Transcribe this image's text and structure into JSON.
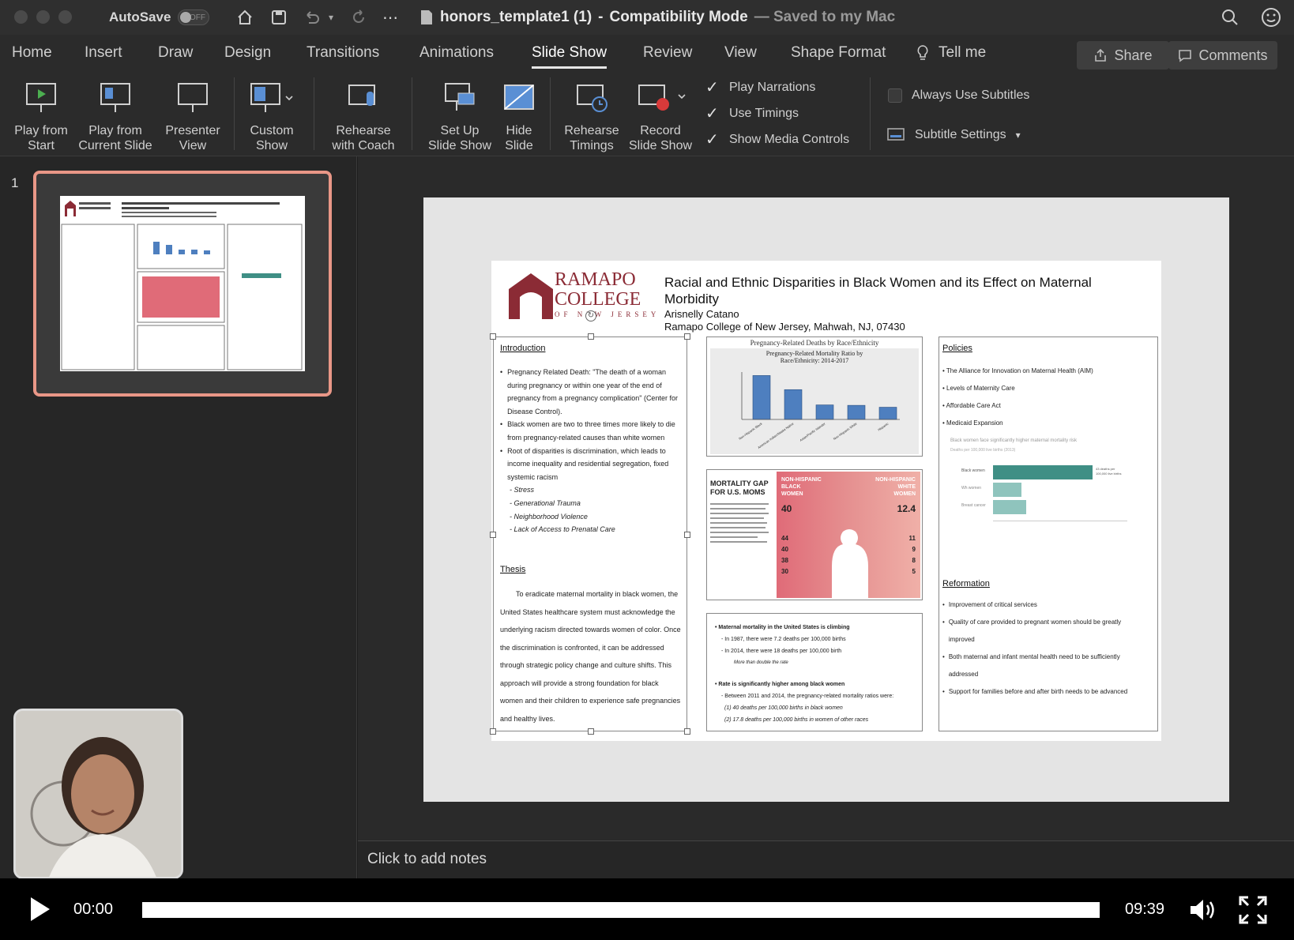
{
  "titlebar": {
    "autosave_label": "AutoSave",
    "autosave_state": "OFF",
    "doc_title": "honors_template1 (1)",
    "separator": "-",
    "mode": "Compatibility Mode",
    "saved_status": "— Saved to my Mac"
  },
  "tabs": [
    "Home",
    "Insert",
    "Draw",
    "Design",
    "Transitions",
    "Animations",
    "Slide Show",
    "Review",
    "View",
    "Shape Format"
  ],
  "active_tab": "Slide Show",
  "tell_me": "Tell me",
  "share_label": "Share",
  "comments_label": "Comments",
  "ribbon": {
    "play_start": [
      "Play from",
      "Start"
    ],
    "play_current": [
      "Play from",
      "Current Slide"
    ],
    "presenter": [
      "Presenter",
      "View"
    ],
    "custom": [
      "Custom",
      "Show"
    ],
    "rehearse_coach": [
      "Rehearse",
      "with Coach"
    ],
    "setup": [
      "Set Up",
      "Slide Show"
    ],
    "hide": [
      "Hide",
      "Slide"
    ],
    "rehearse_timings": [
      "Rehearse",
      "Timings"
    ],
    "record": [
      "Record",
      "Slide Show"
    ],
    "play_narrations": "Play Narrations",
    "use_timings": "Use Timings",
    "show_media_controls": "Show Media Controls",
    "always_subtitles": "Always Use Subtitles",
    "subtitle_settings": "Subtitle Settings"
  },
  "thumbnail_number": "1",
  "notes_placeholder": "Click to add notes",
  "poster": {
    "logo_line1": "RAMAPO",
    "logo_line2": "COLLEGE",
    "logo_line3": "OF NEW JERSEY",
    "title": "Racial and Ethnic Disparities in Black Women and its Effect on Maternal Morbidity",
    "author": "Arisnelly Catano",
    "affiliation": "Ramapo College of New Jersey, Mahwah, NJ, 07430",
    "intro_heading": "Introduction",
    "intro_items": [
      "Pregnancy Related Death: \"The death of a woman during pregnancy or within one year of the end of pregnancy from a pregnancy complication\" (Center for Disease Control).",
      "Black women are two to three times more likely to die from pregnancy-related causes than white women",
      "Root of disparities is discrimination, which leads to income inequality and residential segregation, fixed systemic racism"
    ],
    "intro_sub": [
      "- Stress",
      "- Generational Trauma",
      "- Neighborhood Violence",
      "- Lack of Access to Prenatal Care"
    ],
    "thesis_heading": "Thesis",
    "thesis_text": "To eradicate maternal mortality in black women, the United States healthcare system must acknowledge the underlying racism directed towards women of color. Once the discrimination is confronted, it can be addressed through strategic policy change and culture shifts. This approach will provide a strong foundation for black women and their children to experience safe pregnancies and healthy lives.",
    "chart_title": "Pregnancy-Related Deaths by Race/Ethnicity",
    "chart_inner_title": "Pregnancy-Related Mortality Ratio by Race/Ethnicity: 2014-2017",
    "mortality_gap": "MORTALITY GAP FOR U.S. MOMS",
    "black_label": "NON-HISPANIC BLACK WOMEN",
    "white_label": "NON-HISPANIC WHITE WOMEN",
    "black_value": "40",
    "white_value": "12.4",
    "black_vals": [
      "44",
      "40",
      "38",
      "30"
    ],
    "white_vals": [
      "11",
      "9",
      "8",
      "5"
    ],
    "stats_items": [
      "Maternal mortality in the United States is climbing",
      "- In 1987, there were 7.2 deaths per 100,000 births",
      "- In 2014, there were 18 deaths per 100,000 birth",
      "Rate is significantly higher among black women",
      "- Between 2011 and 2014, the pregnancy-related mortality ratios were:",
      "(1) 40 deaths per 100,000 births in black women",
      "(2) 17.8 deaths per 100,000 births in women of other races"
    ],
    "stats_note": "More than double the rate",
    "policies_heading": "Policies",
    "policies": [
      "The Alliance for Innovation on Maternal Health (AIM)",
      "Levels of Maternity Care",
      "Affordable Care Act",
      "Medicaid Expansion"
    ],
    "mini_chart_title": "Black women face significantly higher maternal mortality risk",
    "mini_chart_sub": "Deaths per 100,000 live births (2013)",
    "mini_bars": [
      "Black women",
      "Wh women",
      "Breast cancer"
    ],
    "mini_bar_value": "43 deaths per 100,000 live births",
    "reformation_heading": "Reformation",
    "reformation": [
      "Improvement of critical services",
      "Quality of care provided to pregnant women should be greatly improved",
      "Both maternal and infant mental health need to be sufficiently addressed",
      "Support for families before and after birth needs to be advanced"
    ]
  },
  "chart_data": {
    "type": "bar",
    "title": "Pregnancy-Related Mortality Ratio by Race/Ethnicity: 2014-2017",
    "categories": [
      "Non-Hispanic Black",
      "American Indian/Alaska Native",
      "Asian/Pacific Islander",
      "Non-Hispanic White",
      "Hispanic"
    ],
    "values": [
      41.7,
      28.3,
      13.8,
      13.4,
      11.6
    ]
  },
  "player": {
    "current_time": "00:00",
    "duration": "09:39"
  },
  "colors": {
    "accent_thumbnail": "#e99787",
    "poster_maroon": "#8b2b35",
    "bar_blue": "#4e7fbf",
    "teal": "#3f8f85",
    "pink": "#e06b78"
  }
}
